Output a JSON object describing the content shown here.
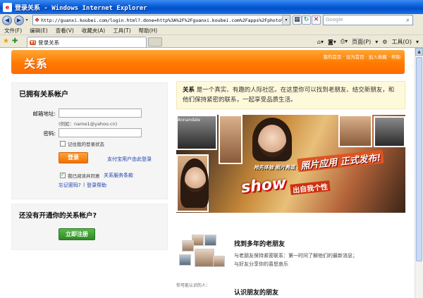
{
  "window": {
    "title": "登录关系 - Windows Internet Explorer",
    "url": "http://guanxi.koubei.com/login.html?.done=http%3A%2F%2Fguanxi.koubei.com%2Fapps%2Fphoto%2Findex.html",
    "search_placeholder": "Google"
  },
  "menu": [
    "文件(F)",
    "编辑(E)",
    "查看(V)",
    "收藏夹(A)",
    "工具(T)",
    "帮助(H)"
  ],
  "tab": {
    "label": "登录关系"
  },
  "toolbar": {
    "page": "页面(P)",
    "tools": "工具(O)"
  },
  "header": {
    "logo": "关系",
    "links": "我的首页 · 设为首页 · 加入收藏 · 帮助"
  },
  "login": {
    "title": "已拥有关系帐户",
    "email_label": "邮箱地址:",
    "email_hint": "(例如：name1@yahoo.cn)",
    "password_label": "密码:",
    "remember_label": "记住我的登录状态",
    "login_button": "登录",
    "alipay_link": "支付宝用户由此登录",
    "agree_text": "我已阅读并同意",
    "terms_link": "关系服务条款",
    "forgot_link": "忘记密码?",
    "separator": "|",
    "help_link": "登录帮助"
  },
  "register": {
    "title": "还没有开通你的关系帐户?",
    "button": "立即注册"
  },
  "intro": {
    "brand": "关系",
    "text": "是一个真实、有趣的人际社区。在这里你可以找到老朋友、结交新朋友，和他们保持紧密的联系，一起享受品质生活。"
  },
  "banner": {
    "tag": "Annandale",
    "line1": "抢先体验  照片秀逗  功能",
    "line2": "照片应用  正式发布!",
    "line3": "show",
    "line4": "出自我个性"
  },
  "features": [
    {
      "title": "找到多年的老朋友",
      "desc1": "与老朋友保持紧密联系：第一时间了解他们的最新消息；",
      "desc2": "与好友分享你的喜怒哀乐"
    },
    {
      "title": "认识朋友的朋友",
      "label": "你可能认识的人："
    }
  ]
}
